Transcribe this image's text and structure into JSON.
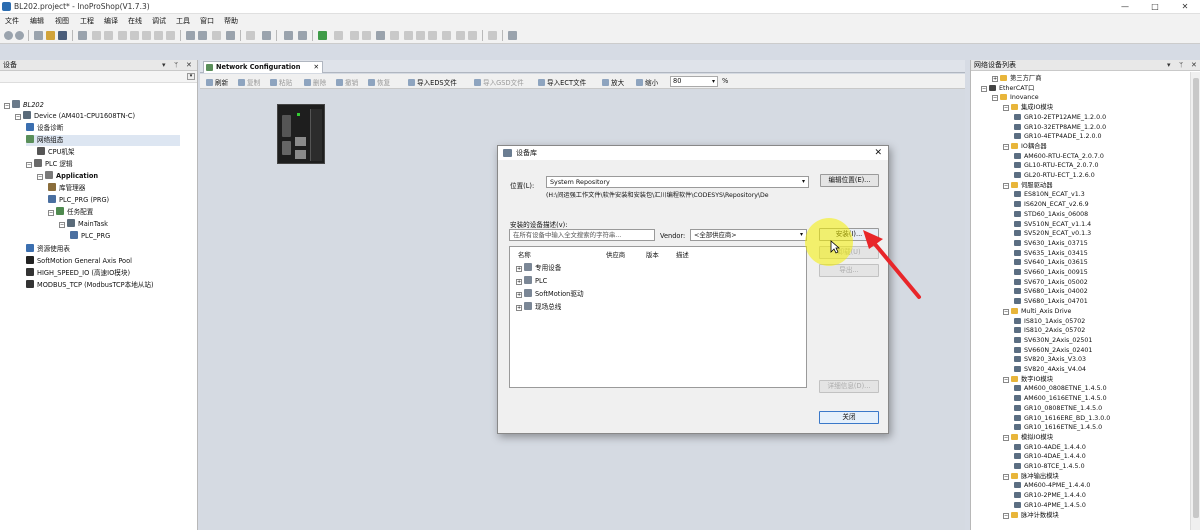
{
  "window": {
    "title": "BL202.project* - InoProShop(V1.7.3)",
    "controls": [
      "—",
      "□",
      "✕"
    ]
  },
  "menu": [
    "文件",
    "编辑",
    "视图",
    "工程",
    "编译",
    "在线",
    "调试",
    "工具",
    "窗口",
    "帮助"
  ],
  "left_panel": {
    "title": "设备",
    "tree": [
      {
        "label": "BL202",
        "indent": 0,
        "icon": "project-icon",
        "italic": true
      },
      {
        "label": "Device (AM401-CPU1608TN-C)",
        "indent": 1,
        "icon": "device-icon"
      },
      {
        "label": "设备诊断",
        "indent": 2,
        "icon": "diagnose-icon"
      },
      {
        "label": "网络组态",
        "indent": 2,
        "icon": "network-icon",
        "selected": true
      },
      {
        "label": "CPU机架",
        "indent": 3,
        "icon": "rack-icon"
      },
      {
        "label": "PLC 逻辑",
        "indent": 2,
        "icon": "plc-logic-icon"
      },
      {
        "label": "Application",
        "indent": 3,
        "icon": "application-icon",
        "bold": true
      },
      {
        "label": "库管理器",
        "indent": 4,
        "icon": "library-icon"
      },
      {
        "label": "PLC_PRG (PRG)",
        "indent": 4,
        "icon": "program-icon"
      },
      {
        "label": "任务配置",
        "indent": 4,
        "icon": "task-config-icon"
      },
      {
        "label": "MainTask",
        "indent": 5,
        "icon": "task-icon"
      },
      {
        "label": "PLC_PRG",
        "indent": 6,
        "icon": "program-icon"
      },
      {
        "label": "资源使用表",
        "indent": 2,
        "icon": "resource-icon"
      },
      {
        "label": "SoftMotion General Axis Pool",
        "indent": 2,
        "icon": "axis-pool-icon"
      },
      {
        "label": "HIGH_SPEED_IO (高速IO模块)",
        "indent": 2,
        "icon": "io-icon"
      },
      {
        "label": "MODBUS_TCP (ModbusTCP本地从站)",
        "indent": 2,
        "icon": "modbus-icon"
      }
    ]
  },
  "center": {
    "tab_label": "Network Configuration",
    "toolbar": [
      {
        "label": "刷新",
        "dim": false
      },
      {
        "label": "复制",
        "dim": true
      },
      {
        "label": "粘贴",
        "dim": true
      },
      {
        "label": "删除",
        "dim": true
      },
      {
        "label": "撤销",
        "dim": true
      },
      {
        "label": "恢复",
        "dim": true
      },
      {
        "label": "导入EDS文件",
        "dim": false
      },
      {
        "label": "导入GSD文件",
        "dim": true
      },
      {
        "label": "导入ECT文件",
        "dim": false
      },
      {
        "label": "放大",
        "dim": false
      },
      {
        "label": "缩小",
        "dim": false
      }
    ],
    "zoom_value": "80",
    "zoom_unit": "%"
  },
  "dialog": {
    "title": "设备库",
    "location_label": "位置(L):",
    "location_value": "System Repository",
    "location_path": "(H:\\间运强工作文件\\软件安装和安装包\\汇川编程软件\\CODESYS\\Repository\\De",
    "edit_location_button": "编辑位置(E)...",
    "installed_label": "安装的设备描述(v):",
    "search_placeholder": "在所有设备中输入全文搜索的字符串...",
    "vendor_label": "Vendor:",
    "vendor_value": "<全部供应商>",
    "columns": [
      "名称",
      "供应商",
      "版本",
      "描述"
    ],
    "rows": [
      {
        "label": "专用设备",
        "icon": "folder-icon"
      },
      {
        "label": "PLC",
        "icon": "folder-icon"
      },
      {
        "label": "SoftMotion驱动",
        "icon": "folder-icon"
      },
      {
        "label": "现场总线",
        "icon": "folder-icon"
      }
    ],
    "install_button": "安装(I)...",
    "uninstall_button": "卸载(U)",
    "export_button": "导出...",
    "details_button": "详细信息(D)...",
    "close_button": "关闭",
    "close_glyph": "✕"
  },
  "right_panel": {
    "title": "网络设备列表",
    "tree": [
      {
        "label": "第三方厂商",
        "indent": 1,
        "type": "folder"
      },
      {
        "label": "EtherCAT口",
        "indent": 0,
        "type": "port"
      },
      {
        "label": "Inovance",
        "indent": 1,
        "type": "folder"
      },
      {
        "label": "集成IO模块",
        "indent": 2,
        "type": "folder"
      },
      {
        "label": "GR10-2ETP12AME_1.2.0.0",
        "indent": 3,
        "type": "item"
      },
      {
        "label": "GR10-32ETP8AME_1.2.0.0",
        "indent": 3,
        "type": "item"
      },
      {
        "label": "GR10-4ETP4ADE_1.2.0.0",
        "indent": 3,
        "type": "item"
      },
      {
        "label": "IO耦合器",
        "indent": 2,
        "type": "folder"
      },
      {
        "label": "AM600-RTU-ECTA_2.0.7.0",
        "indent": 3,
        "type": "item"
      },
      {
        "label": "GL10-RTU-ECTA_2.0.7.0",
        "indent": 3,
        "type": "item"
      },
      {
        "label": "GL20-RTU-ECT_1.2.6.0",
        "indent": 3,
        "type": "item"
      },
      {
        "label": "伺服驱动器",
        "indent": 2,
        "type": "folder"
      },
      {
        "label": "ES810N_ECAT_v1.3",
        "indent": 3,
        "type": "item"
      },
      {
        "label": "IS620N_ECAT_v2.6.9",
        "indent": 3,
        "type": "item"
      },
      {
        "label": "STD60_1Axis_06008",
        "indent": 3,
        "type": "item"
      },
      {
        "label": "SV510N_ECAT_v1.1.4",
        "indent": 3,
        "type": "item"
      },
      {
        "label": "SV520N_ECAT_v0.1.3",
        "indent": 3,
        "type": "item"
      },
      {
        "label": "SV630_1Axis_03715",
        "indent": 3,
        "type": "item"
      },
      {
        "label": "SV635_1Axis_03415",
        "indent": 3,
        "type": "item"
      },
      {
        "label": "SV640_1Axis_03615",
        "indent": 3,
        "type": "item"
      },
      {
        "label": "SV660_1Axis_00915",
        "indent": 3,
        "type": "item"
      },
      {
        "label": "SV670_1Axis_05002",
        "indent": 3,
        "type": "item"
      },
      {
        "label": "SV680_1Axis_04002",
        "indent": 3,
        "type": "item"
      },
      {
        "label": "SV680_1Axis_04701",
        "indent": 3,
        "type": "item"
      },
      {
        "label": "Multi_Axis Drive",
        "indent": 2,
        "type": "folder"
      },
      {
        "label": "IS810_1Axis_05702",
        "indent": 3,
        "type": "item"
      },
      {
        "label": "IS810_2Axis_05702",
        "indent": 3,
        "type": "item"
      },
      {
        "label": "SV630N_2Axis_02501",
        "indent": 3,
        "type": "item"
      },
      {
        "label": "SV660N_2Axis_02401",
        "indent": 3,
        "type": "item"
      },
      {
        "label": "SV820_3Axis_V3.03",
        "indent": 3,
        "type": "item"
      },
      {
        "label": "SV820_4Axis_V4.04",
        "indent": 3,
        "type": "item"
      },
      {
        "label": "数字IO模块",
        "indent": 2,
        "type": "folder"
      },
      {
        "label": "AM600_0808ETNE_1.4.5.0",
        "indent": 3,
        "type": "item"
      },
      {
        "label": "AM600_1616ETNE_1.4.5.0",
        "indent": 3,
        "type": "item"
      },
      {
        "label": "GR10_0808ETNE_1.4.5.0",
        "indent": 3,
        "type": "item"
      },
      {
        "label": "GR10_1616ERE_BD_1.3.0.0",
        "indent": 3,
        "type": "item"
      },
      {
        "label": "GR10_1616ETNE_1.4.5.0",
        "indent": 3,
        "type": "item"
      },
      {
        "label": "模拟IO模块",
        "indent": 2,
        "type": "folder"
      },
      {
        "label": "GR10-4ADE_1.4.4.0",
        "indent": 3,
        "type": "item"
      },
      {
        "label": "GR10-4DAE_1.4.4.0",
        "indent": 3,
        "type": "item"
      },
      {
        "label": "GR10-8TCE_1.4.5.0",
        "indent": 3,
        "type": "item"
      },
      {
        "label": "脉冲输出模块",
        "indent": 2,
        "type": "folder"
      },
      {
        "label": "AM600-4PME_1.4.4.0",
        "indent": 3,
        "type": "item"
      },
      {
        "label": "GR10-2PME_1.4.4.0",
        "indent": 3,
        "type": "item"
      },
      {
        "label": "GR10-4PME_1.4.5.0",
        "indent": 3,
        "type": "item"
      },
      {
        "label": "脉冲计数模块",
        "indent": 2,
        "type": "folder"
      }
    ]
  },
  "colors": {
    "accent": "#2b6cb0",
    "highlight": "#f6f000",
    "arrow": "#e8262a",
    "selection": "#dde6f2",
    "folder": "#e8b53a"
  }
}
